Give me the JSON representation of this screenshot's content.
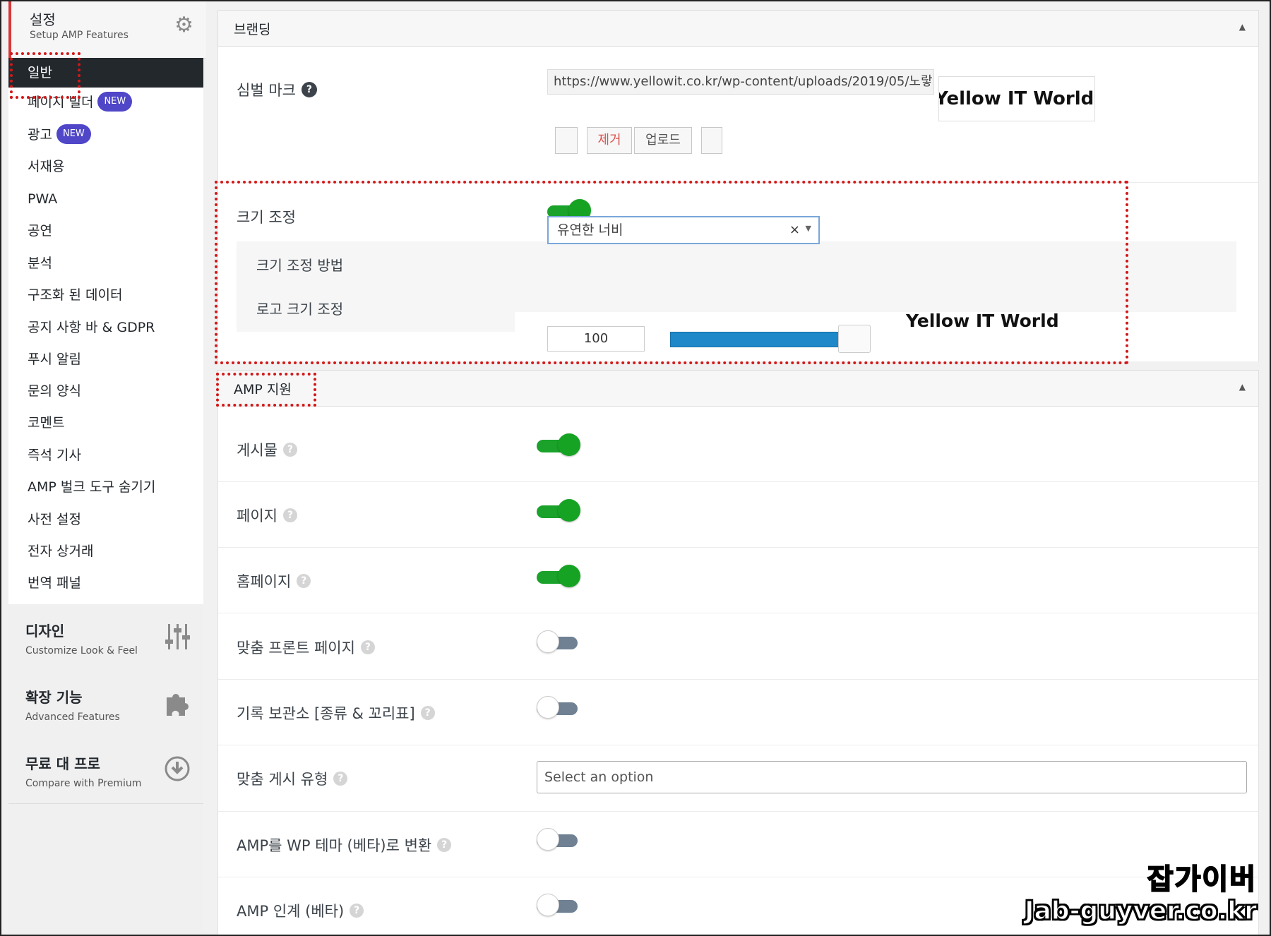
{
  "sidebar": {
    "setup": {
      "title": "설정",
      "subtitle": "Setup AMP Features",
      "icon": "gears-icon"
    },
    "menu": [
      {
        "label": "일반",
        "active": true
      },
      {
        "label": "페이지 빌더",
        "badge": "NEW"
      },
      {
        "label": "광고",
        "badge": "NEW"
      },
      {
        "label": "서재용"
      },
      {
        "label": "PWA"
      },
      {
        "label": "공연"
      },
      {
        "label": "분석"
      },
      {
        "label": "구조화 된 데이터"
      },
      {
        "label": "공지 사항 바 & GDPR"
      },
      {
        "label": "푸시 알림"
      },
      {
        "label": "문의 양식"
      },
      {
        "label": "코멘트"
      },
      {
        "label": "즉석 기사"
      },
      {
        "label": "AMP 벌크 도구 숨기기"
      },
      {
        "label": "사전 설정"
      },
      {
        "label": "전자 상거래"
      },
      {
        "label": "번역 패널"
      }
    ],
    "design": {
      "title": "디자인",
      "subtitle": "Customize Look & Feel",
      "icon": "sliders-icon"
    },
    "extensions": {
      "title": "확장 기능",
      "subtitle": "Advanced Features",
      "icon": "puzzle-icon"
    },
    "pro": {
      "title": "무료 대 프로",
      "subtitle": "Compare with Premium",
      "icon": "download-circle-icon"
    }
  },
  "branding": {
    "title": "브랜딩",
    "logo_label": "심벌 마크",
    "logo_url": "https://www.yellowit.co.kr/wp-content/uploads/2019/05/노랗ㄴ",
    "logo_text": "Yellow IT World",
    "remove_label": "제거",
    "upload_label": "업로드",
    "resize_label": "크기 조정",
    "resize_on": true,
    "resize_method_label": "크기 조정 방법",
    "resize_method_value": "유연한 너비",
    "logo_size_label": "로고 크기 조정",
    "logo_size_value": "100",
    "logo_size_fraction": 0.87,
    "preview_text": "Yellow IT World"
  },
  "amp_support": {
    "title": "AMP 지원",
    "rows": [
      {
        "label": "게시물",
        "type": "toggle",
        "on": true
      },
      {
        "label": "페이지",
        "type": "toggle",
        "on": true
      },
      {
        "label": "홈페이지",
        "type": "toggle",
        "on": true
      },
      {
        "label": "맞춤 프론트 페이지",
        "type": "toggle",
        "on": false
      },
      {
        "label": "기록 보관소 [종류 & 꼬리표]",
        "type": "toggle",
        "on": false
      },
      {
        "label": "맞춤 게시 유형",
        "type": "select",
        "placeholder": "Select an option"
      },
      {
        "label": "AMP를 WP 테마 (베타)로 변환",
        "type": "toggle",
        "on": false
      },
      {
        "label": "AMP 인계 (베타)",
        "type": "toggle",
        "on": false
      }
    ]
  },
  "watermark": {
    "korean": "잡가이버",
    "url": "Jab-guyver.co.kr"
  },
  "colors": {
    "toggle_on": "#1aa22a",
    "toggle_off": "#6f8193",
    "annotation": "#d21818",
    "active_menu": "#23282d",
    "badge": "#4f46c8"
  }
}
